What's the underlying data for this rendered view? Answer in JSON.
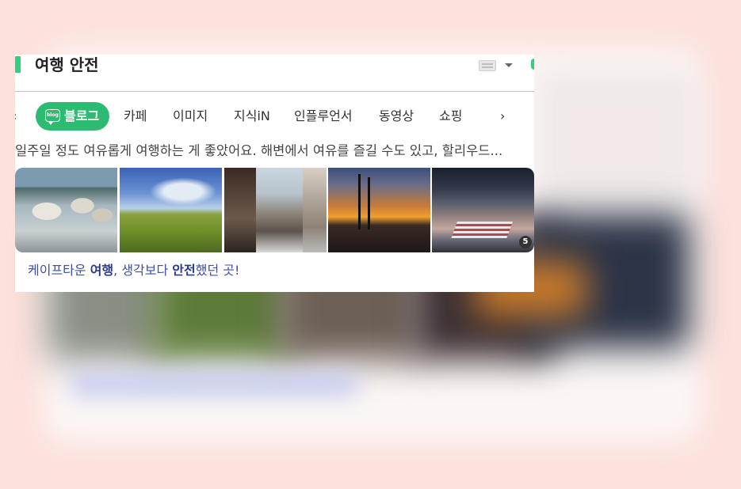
{
  "header": {
    "title": "여행 안전"
  },
  "tabs": {
    "items": [
      {
        "label": "블로그",
        "active": true
      },
      {
        "label": "카페"
      },
      {
        "label": "이미지"
      },
      {
        "label": "지식iN"
      },
      {
        "label": "인플루언서"
      },
      {
        "label": "동영상"
      },
      {
        "label": "쇼핑"
      }
    ]
  },
  "snippet": {
    "text": "일주일 정도 여유롭게 여행하는 게 좋았어요. 해변에서 여유를 즐길 수도 있고, 할리우드..."
  },
  "thumbnails": {
    "count_badge": "5"
  },
  "result_link": {
    "part1": "케이프타운 ",
    "part2": "여행",
    "part3": ", 생각보다 ",
    "part4": "안전",
    "part5": "했던 곳!"
  },
  "colors": {
    "accent": "#2fd27a",
    "active_tab": "#2dbb72",
    "link": "#3c4cb0",
    "background": "#fde1dc"
  }
}
